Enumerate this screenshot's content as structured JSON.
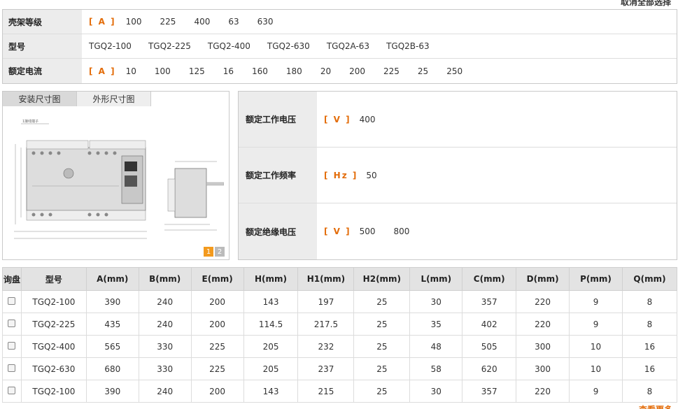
{
  "top_link": "取消全部选择",
  "filters": {
    "frame": {
      "label": "壳架等级",
      "unit": "[ A ]",
      "values": [
        "100",
        "225",
        "400",
        "63",
        "630"
      ]
    },
    "model": {
      "label": "型号",
      "values": [
        "TGQ2-100",
        "TGQ2-225",
        "TGQ2-400",
        "TGQ2-630",
        "TGQ2A-63",
        "TGQ2B-63"
      ]
    },
    "current": {
      "label": "额定电流",
      "unit": "[ A ]",
      "values": [
        "10",
        "100",
        "125",
        "16",
        "160",
        "180",
        "20",
        "200",
        "225",
        "25",
        "250"
      ]
    }
  },
  "drawing_panel": {
    "tabs": [
      "安装尺寸图",
      "外形尺寸图"
    ],
    "active_tab": 0,
    "pages": [
      "1",
      "2"
    ],
    "current_page": "1",
    "caption": "1接线端子"
  },
  "specs": {
    "voltage": {
      "label": "额定工作电压",
      "unit": "[ V ]",
      "values": [
        "400"
      ]
    },
    "frequency": {
      "label": "额定工作频率",
      "unit": "[ Hz ]",
      "values": [
        "50"
      ]
    },
    "insulation": {
      "label": "额定绝缘电压",
      "unit": "[ V ]",
      "values": [
        "500",
        "800"
      ]
    }
  },
  "table": {
    "headers": [
      "询盘",
      "型号",
      "A(mm)",
      "B(mm)",
      "E(mm)",
      "H(mm)",
      "H1(mm)",
      "H2(mm)",
      "L(mm)",
      "C(mm)",
      "D(mm)",
      "P(mm)",
      "Q(mm)"
    ],
    "rows": [
      [
        "TGQ2-100",
        "390",
        "240",
        "200",
        "143",
        "197",
        "25",
        "30",
        "357",
        "220",
        "9",
        "8"
      ],
      [
        "TGQ2-225",
        "435",
        "240",
        "200",
        "114.5",
        "217.5",
        "25",
        "35",
        "402",
        "220",
        "9",
        "8"
      ],
      [
        "TGQ2-400",
        "565",
        "330",
        "225",
        "205",
        "232",
        "25",
        "48",
        "505",
        "300",
        "10",
        "16"
      ],
      [
        "TGQ2-630",
        "680",
        "330",
        "225",
        "205",
        "237",
        "25",
        "58",
        "620",
        "300",
        "10",
        "16"
      ],
      [
        "TGQ2-100",
        "390",
        "240",
        "200",
        "143",
        "215",
        "25",
        "30",
        "357",
        "220",
        "9",
        "8"
      ]
    ]
  },
  "more_link": "查看更多"
}
